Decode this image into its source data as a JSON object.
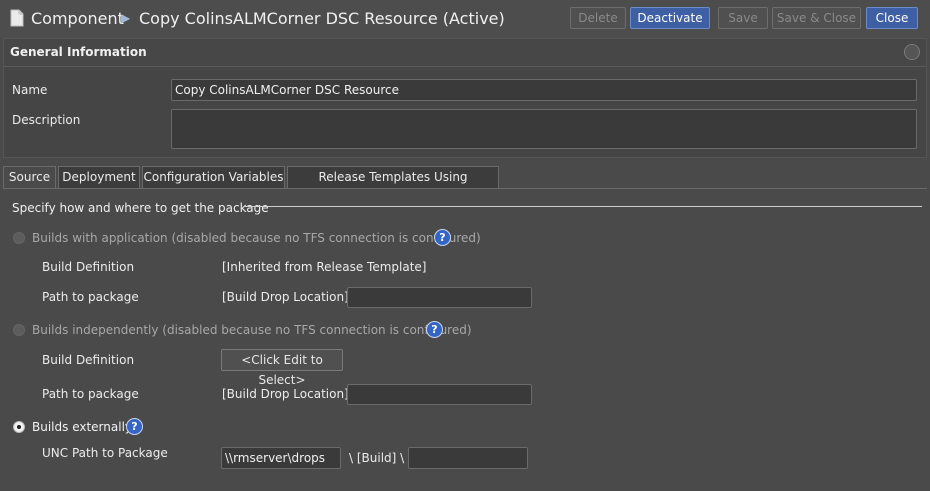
{
  "header": {
    "breadcrumb_root": "Component",
    "breadcrumb_sep": "▶",
    "title": "Copy ColinsALMCorner DSC Resource (Active)"
  },
  "toolbar": {
    "delete": "Delete",
    "deactivate": "Deactivate",
    "save": "Save",
    "save_close": "Save & Close",
    "close": "Close"
  },
  "general": {
    "title": "General Information",
    "name_label": "Name",
    "name_value": "Copy ColinsALMCorner DSC Resource",
    "description_label": "Description",
    "description_value": ""
  },
  "tabs": [
    "Source",
    "Deployment",
    "Configuration Variables",
    "Release Templates Using Component"
  ],
  "source": {
    "section_title": "Specify how and where to get the package",
    "opt1_label": "Builds with application (disabled because no TFS connection is configured)",
    "opt1_build_def_label": "Build Definition",
    "opt1_build_def_value": "[Inherited from Release Template]",
    "opt1_path_label": "Path to package",
    "opt1_path_prefix": "[Build Drop Location] \\",
    "opt1_path_value": "",
    "opt2_label": "Builds independently (disabled because no TFS connection is configured)",
    "opt2_build_def_label": "Build Definition",
    "opt2_build_def_button": "<Click Edit to Select>",
    "opt2_path_label": "Path to package",
    "opt2_path_prefix": "[Build Drop Location] \\",
    "opt2_path_value": "",
    "opt3_label": "Builds externally",
    "opt3_unc_label": "UNC Path to Package",
    "opt3_unc_value": "\\\\rmserver\\drops",
    "opt3_unc_mid": "\\ [Build] \\",
    "opt3_unc_suffix_value": "",
    "help_glyph": "?"
  },
  "colors": {
    "accent": "#3e5fa3",
    "help": "#3465c4"
  }
}
